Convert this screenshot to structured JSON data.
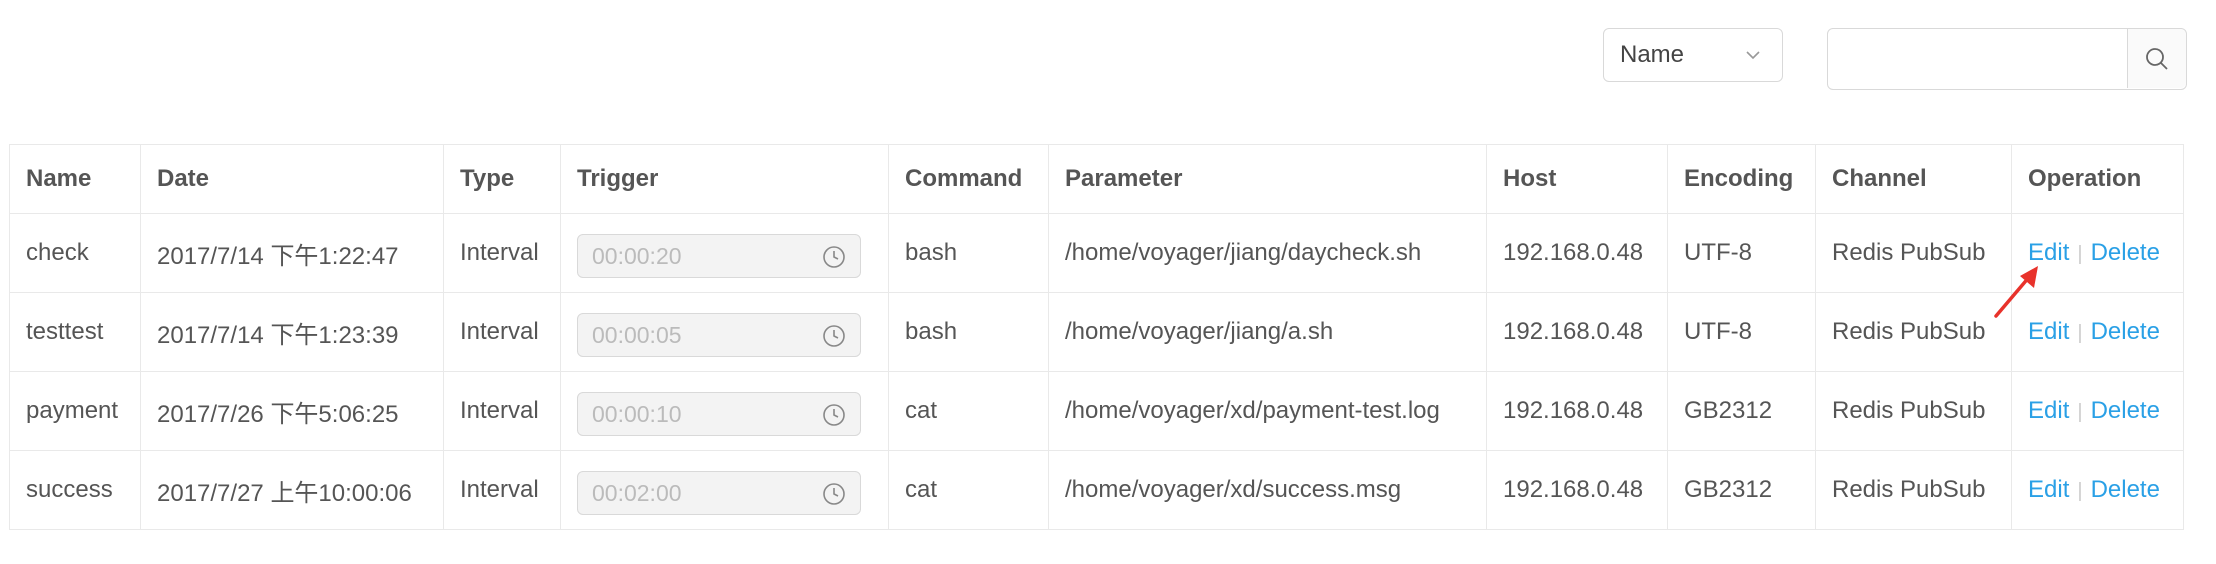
{
  "filter": {
    "selected": "Name"
  },
  "search": {
    "value": ""
  },
  "columns": [
    "Name",
    "Date",
    "Type",
    "Trigger",
    "Command",
    "Parameter",
    "Host",
    "Encoding",
    "Channel",
    "Operation"
  ],
  "rows": [
    {
      "name": "check",
      "date": "2017/7/14 下午1:22:47",
      "type": "Interval",
      "trigger": "00:00:20",
      "command": "bash",
      "parameter": "/home/voyager/jiang/daycheck.sh",
      "host": "192.168.0.48",
      "encoding": "UTF-8",
      "channel": "Redis PubSub"
    },
    {
      "name": "testtest",
      "date": "2017/7/14 下午1:23:39",
      "type": "Interval",
      "trigger": "00:00:05",
      "command": "bash",
      "parameter": "/home/voyager/jiang/a.sh",
      "host": "192.168.0.48",
      "encoding": "UTF-8",
      "channel": "Redis PubSub"
    },
    {
      "name": "payment",
      "date": "2017/7/26 下午5:06:25",
      "type": "Interval",
      "trigger": "00:00:10",
      "command": "cat",
      "parameter": "/home/voyager/xd/payment-test.log",
      "host": "192.168.0.48",
      "encoding": "GB2312",
      "channel": "Redis PubSub"
    },
    {
      "name": "success",
      "date": "2017/7/27 上午10:00:06",
      "type": "Interval",
      "trigger": "00:02:00",
      "command": "cat",
      "parameter": "/home/voyager/xd/success.msg",
      "host": "192.168.0.48",
      "encoding": "GB2312",
      "channel": "Redis PubSub"
    }
  ],
  "operation": {
    "edit_label": "Edit",
    "separator": "|",
    "delete_label": "Delete"
  },
  "colors": {
    "link": "#2aa0e6",
    "arrow": "#e8322b",
    "border": "#e9e9e9"
  },
  "icons": {
    "select": "chevron-down-icon",
    "search": "search-icon",
    "trigger": "clock-icon",
    "annotation": "red-arrow-icon"
  }
}
